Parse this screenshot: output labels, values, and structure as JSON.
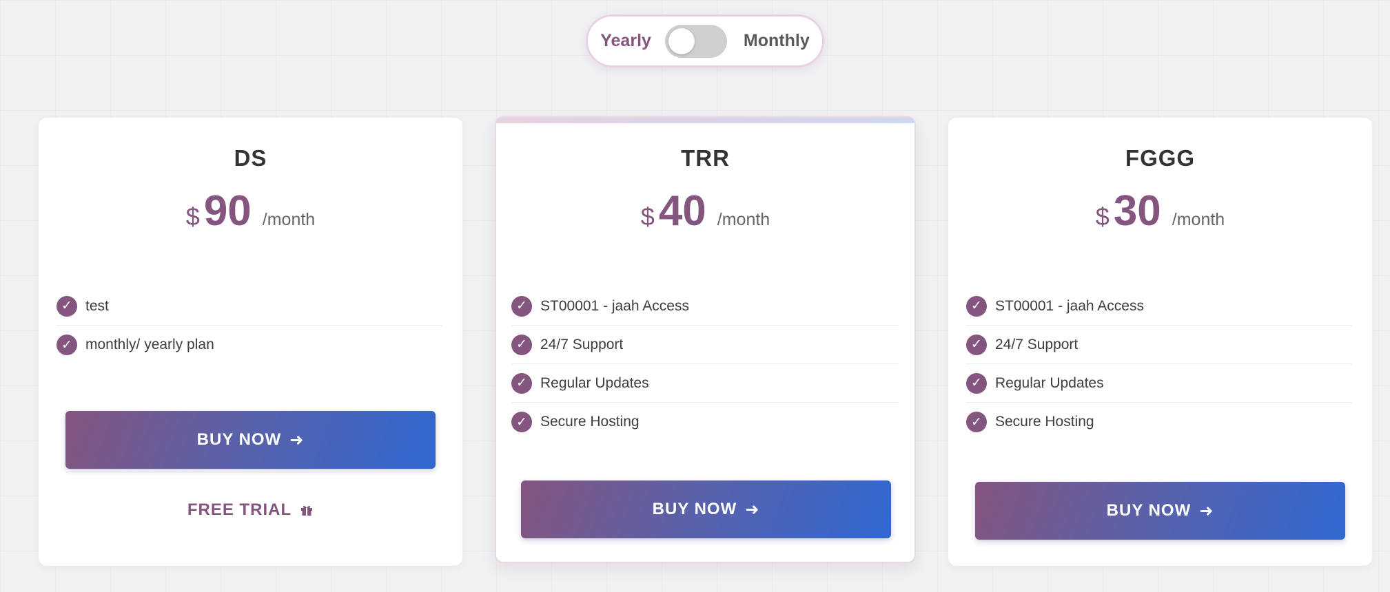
{
  "billing_toggle": {
    "yearly_label": "Yearly",
    "monthly_label": "Monthly",
    "selected": "Yearly"
  },
  "plans": [
    {
      "name": "DS",
      "currency": "$",
      "amount": "90",
      "period": "/month",
      "features": [
        "test",
        "monthly/ yearly plan"
      ],
      "buy_label": "BUY NOW",
      "free_trial_label": "FREE TRIAL"
    },
    {
      "name": "TRR",
      "currency": "$",
      "amount": "40",
      "period": "/month",
      "features": [
        "ST00001 - jaah Access",
        "24/7 Support",
        "Regular Updates",
        "Secure Hosting"
      ],
      "buy_label": "BUY NOW"
    },
    {
      "name": "FGGG",
      "currency": "$",
      "amount": "30",
      "period": "/month",
      "features": [
        "ST00001 - jaah Access",
        "24/7 Support",
        "Regular Updates",
        "Secure Hosting"
      ],
      "buy_label": "BUY NOW"
    }
  ],
  "icons": {
    "check": "check-icon",
    "arrow": "arrow-right-icon",
    "gift": "gift-icon"
  },
  "colors": {
    "accent": "#84557f",
    "button_gradient_start": "#84557f",
    "button_gradient_end": "#3068d2"
  }
}
